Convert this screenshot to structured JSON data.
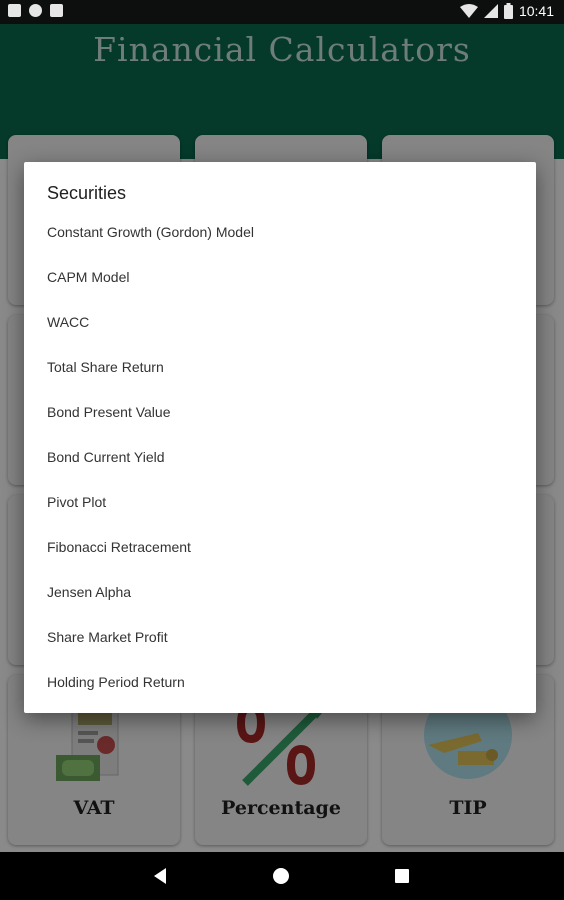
{
  "status_bar": {
    "time": "10:41",
    "left_icons": [
      "notification-a-icon",
      "notification-b-icon",
      "sd-card-icon"
    ],
    "right_icons": [
      "wifi-icon",
      "signal-icon",
      "battery-icon"
    ]
  },
  "app": {
    "title": "Financial Calculators"
  },
  "cards": [
    {
      "label": "VAT",
      "icon": "tax-receipt-icon"
    },
    {
      "label": "Percentage",
      "icon": "percentage-icon"
    },
    {
      "label": "TIP",
      "icon": "tip-hand-icon"
    }
  ],
  "dialog": {
    "title": "Securities",
    "items": [
      "Constant Growth (Gordon) Model",
      "CAPM Model",
      "WACC",
      "Total Share Return",
      "Bond Present Value",
      "Bond Current Yield",
      "Pivot Plot",
      "Fibonacci Retracement",
      "Jensen Alpha",
      "Share Market Profit",
      "Holding Period Return"
    ]
  },
  "nav": {
    "buttons": [
      "back-icon",
      "home-icon",
      "recents-icon"
    ]
  }
}
